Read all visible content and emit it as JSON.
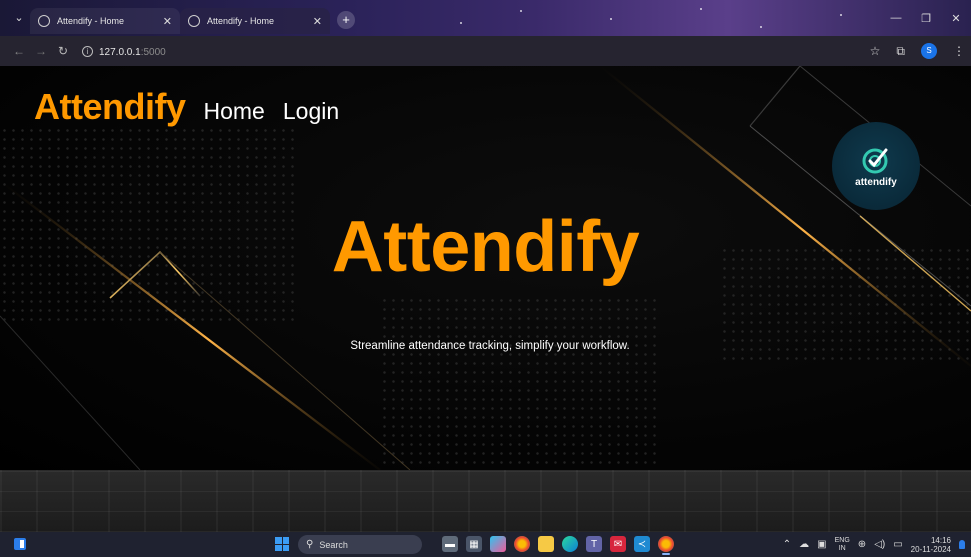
{
  "browser": {
    "tabs": [
      {
        "title": "Attendify - Home",
        "active": false
      },
      {
        "title": "Attendify - Home",
        "active": true
      }
    ],
    "new_tab_label": "+",
    "url_host": "127.0.0.1",
    "url_port": ":5000",
    "profile_initial": "S"
  },
  "page": {
    "navbar": {
      "brand": "Attendify",
      "links": [
        "Home",
        "Login"
      ]
    },
    "logo_text": "attendify",
    "hero": {
      "title": "Attendify",
      "subtitle": "Streamline attendance tracking, simplify your workflow."
    },
    "accent_color": "#ff9900"
  },
  "taskbar": {
    "search_placeholder": "Search",
    "lang_primary": "ENG",
    "lang_secondary": "IN",
    "time": "14:16",
    "date": "20-11-2024",
    "apps": [
      "file-manager-icon",
      "calendar-icon",
      "copilot-icon",
      "chrome-icon",
      "folder-icon",
      "edge-icon",
      "teams-icon",
      "mail-icon",
      "vscode-icon",
      "chrome-active-icon"
    ]
  }
}
